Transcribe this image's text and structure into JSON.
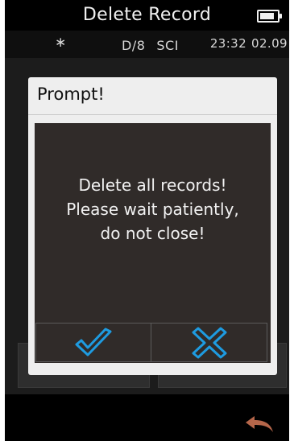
{
  "header": {
    "title": "Delete Record",
    "battery_level": 0.85
  },
  "status": {
    "mode": "D/8",
    "observer": "SCI",
    "time": "23:32",
    "date": "02.09",
    "bluetooth_icon": "bluetooth-icon"
  },
  "dialog": {
    "title": "Prompt!",
    "message_lines": [
      "Delete all records!",
      "Please wait patiently,",
      "do not close!"
    ],
    "confirm_icon": "check-icon",
    "cancel_icon": "x-icon"
  },
  "footer": {
    "back_icon": "back-arrow-icon"
  },
  "colors": {
    "accent": "#1e9be0",
    "back_arrow": "#b5664a",
    "dialog_body": "#302b29"
  }
}
